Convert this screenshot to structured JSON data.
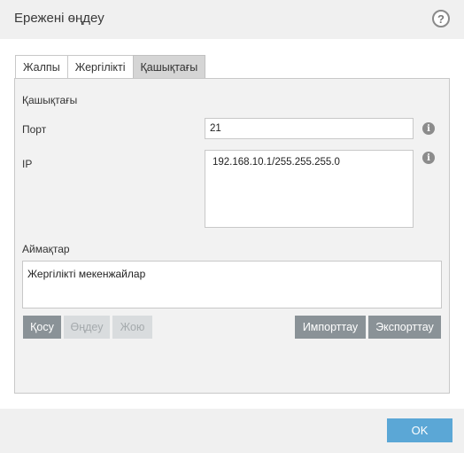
{
  "dialog": {
    "title": "Ережені өңдеу",
    "help_icon": "question-icon",
    "help_label": "?"
  },
  "tabs": [
    {
      "label": "Жалпы",
      "active": false
    },
    {
      "label": "Жергілікті",
      "active": false
    },
    {
      "label": "Қашықтағы",
      "active": true
    }
  ],
  "remote": {
    "section_title": "Қашықтағы",
    "port_label": "Порт",
    "port_value": "21",
    "ip_label": "IP",
    "ip_value": "192.168.10.1/255.255.255.0",
    "info_icon": "info-icon",
    "info_glyph": "i"
  },
  "zones": {
    "label": "Аймақтар",
    "items": [
      "Жергілікті мекенжайлар"
    ]
  },
  "buttons": {
    "add": "Қосу",
    "edit": "Өңдеу",
    "delete": "Жою",
    "import": "Импорттау",
    "export": "Экспорттау"
  },
  "footer": {
    "ok": "OK"
  },
  "colors": {
    "accent": "#5ba7d6",
    "button_dark": "#8a9297",
    "button_disabled": "#d9dcde"
  }
}
